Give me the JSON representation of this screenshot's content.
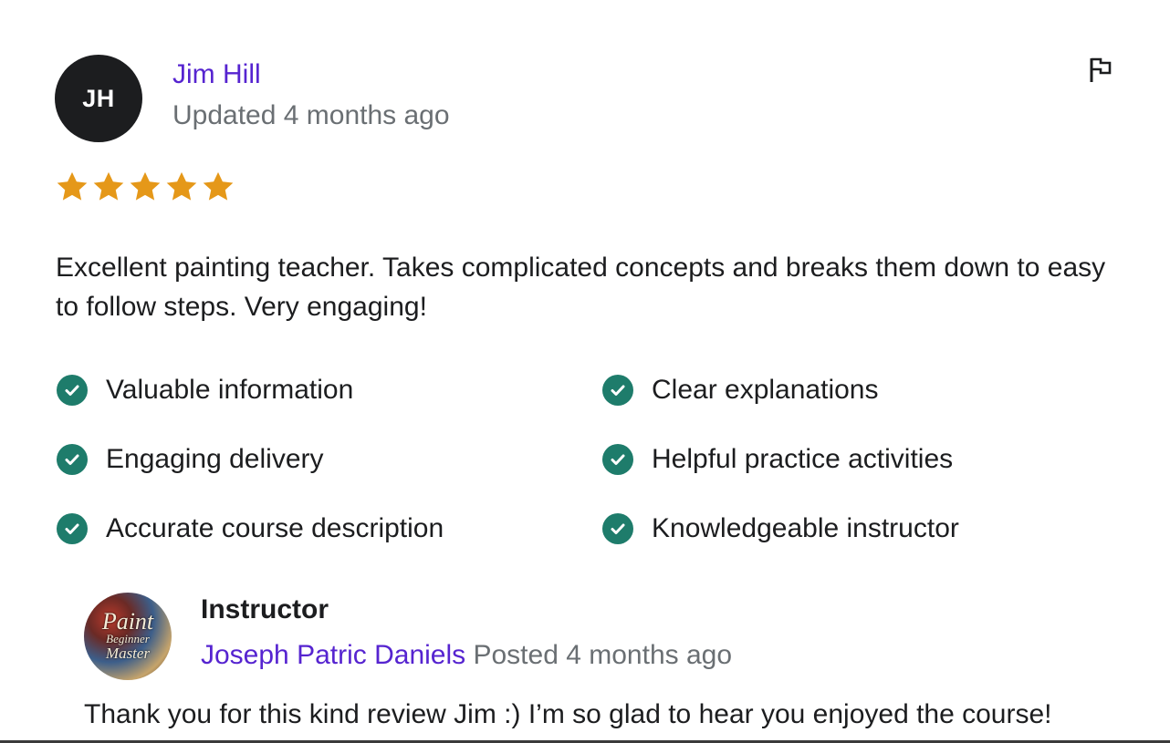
{
  "review": {
    "avatar_initials": "JH",
    "reviewer_name": "Jim Hill",
    "updated": "Updated 4 months ago",
    "rating": 5,
    "text": "Excellent painting teacher. Takes complicated concepts and breaks them down to easy to follow steps. Very engaging!",
    "flag_icon": "flag-icon"
  },
  "tags": [
    "Valuable information",
    "Clear explanations",
    "Engaging delivery",
    "Helpful practice activities",
    "Accurate course description",
    "Knowledgeable instructor"
  ],
  "response": {
    "avatar_text": {
      "line1": "Paint",
      "line2": "Beginner",
      "line3": "Master"
    },
    "heading": "Instructor",
    "name": "Joseph Patric Daniels",
    "posted": " Posted 4 months ago",
    "text": "Thank you for this kind review Jim :) I’m so glad to hear you enjoyed the course!"
  },
  "colors": {
    "link": "#5624d0",
    "muted": "#6a6f73",
    "star": "#e59819",
    "check": "#1e7c6b",
    "avatar_bg": "#1c1d1f"
  }
}
